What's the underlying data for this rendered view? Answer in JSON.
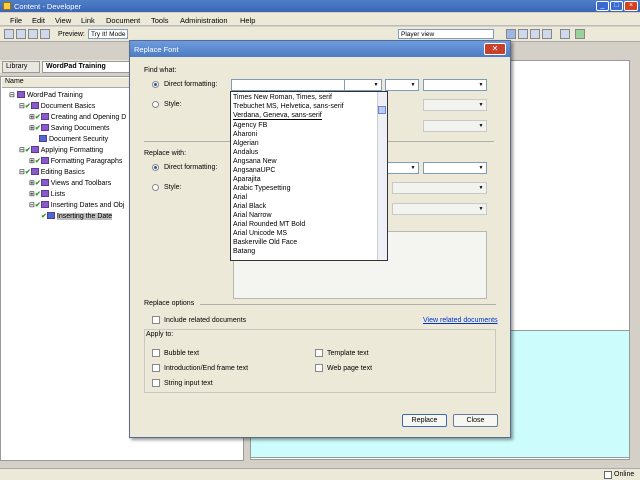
{
  "window": {
    "title": "Content - Developer"
  },
  "menu": [
    "File",
    "Edit",
    "View",
    "Link",
    "Document",
    "Tools",
    "Administration",
    "Help"
  ],
  "toolbar": {
    "preview_label": "Preview:",
    "mode_value": "Try It! Mode",
    "player_value": "Player view"
  },
  "tabs": [
    "Library",
    "WordPad Training"
  ],
  "tree": {
    "header": "Name",
    "items": [
      "WordPad Training",
      "Document Basics",
      "Creating and Opening D",
      "Saving Documents",
      "Document Security",
      "Applying Formatting",
      "Formatting Paragraphs",
      "Editing Basics",
      "Views and Toolbars",
      "Lists",
      "Inserting Dates and Obj",
      "Inserting the Date"
    ]
  },
  "status": {
    "text": "Online"
  },
  "dialog": {
    "title": "Replace Font",
    "find_what": "Find what:",
    "replace_with": "Replace with:",
    "direct_formatting": "Direct formatting:",
    "style": "Style:",
    "replace_options": "Replace options",
    "include_related": "Include related documents",
    "view_related": "View related documents",
    "apply_to": "Apply to:",
    "apply_items": [
      "Bubble text",
      "Introduction/End frame text",
      "String input text",
      "Template text",
      "Web page text"
    ],
    "replace_button": "Replace",
    "close_button": "Close"
  },
  "font_list": [
    "Times New Roman, Times, serif",
    "Trebuchet MS, Helvetica, sans-serif",
    "Verdana, Geneva, sans-serif",
    "Agency FB",
    "Aharoni",
    "Algerian",
    "Andalus",
    "Angsana New",
    "AngsanaUPC",
    "Aparajita",
    "Arabic Typesetting",
    "Arial",
    "Arial Black",
    "Arial Narrow",
    "Arial Rounded MT Bold",
    "Arial Unicode MS",
    "Baskerville Old Face",
    "Batang"
  ]
}
